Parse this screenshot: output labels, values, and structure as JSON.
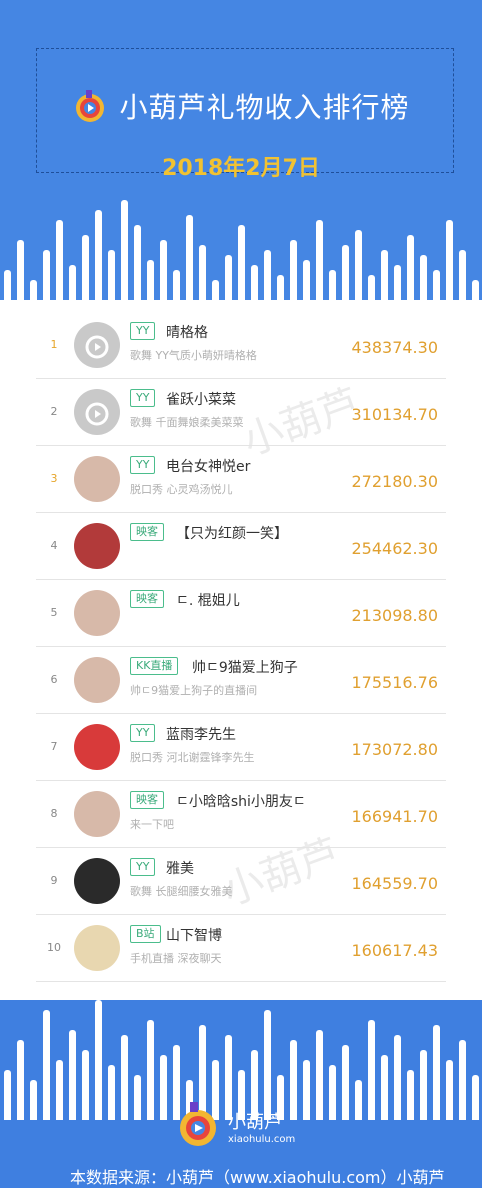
{
  "header": {
    "title": "小葫芦礼物收入排行榜",
    "date": "2018年2月7日"
  },
  "rankings": [
    {
      "rank": "1",
      "platform": "YY",
      "name": "晴格格",
      "desc": "歌舞 YY气质小萌妍晴格格",
      "score": "438374.30",
      "avatar": "default-avatar"
    },
    {
      "rank": "2",
      "platform": "YY",
      "name": "雀跃小菜菜",
      "desc": "歌舞 千面舞娘柔美菜菜",
      "score": "310134.70",
      "avatar": "default-avatar"
    },
    {
      "rank": "3",
      "platform": "YY",
      "name": "电台女神悦er",
      "desc": "脱口秀 心灵鸡汤悦儿",
      "score": "272180.30",
      "avatar": "photo"
    },
    {
      "rank": "4",
      "platform": "映客",
      "name": "【只为红颜一笑】",
      "desc": "",
      "score": "254462.30",
      "avatar": "photo-car"
    },
    {
      "rank": "5",
      "platform": "映客",
      "name": "ㄷ. 棍姐儿",
      "desc": "",
      "score": "213098.80",
      "avatar": "photo"
    },
    {
      "rank": "6",
      "platform": "KK直播",
      "name": "帅ㄷ9猫爱上狗子",
      "desc": "帅ㄷ9猫爱上狗子的直播间",
      "score": "175516.76",
      "avatar": "photo"
    },
    {
      "rank": "7",
      "platform": "YY",
      "name": "蓝雨李先生",
      "desc": "脱口秀 河北谢霆锋李先生",
      "score": "173072.80",
      "avatar": "cartoon"
    },
    {
      "rank": "8",
      "platform": "映客",
      "name": "ㄷ小晗晗shi小朋友ㄷ",
      "desc": "来一下吧",
      "score": "166941.70",
      "avatar": "photo"
    },
    {
      "rank": "9",
      "platform": "YY",
      "name": "雅美",
      "desc": "歌舞 长腿细腰女雅美",
      "score": "164559.70",
      "avatar": "photo-dark"
    },
    {
      "rank": "10",
      "platform": "B站",
      "name": "山下智博",
      "desc": "手机直播 深夜聊天",
      "score": "160617.43",
      "avatar": "cartoon-glasses"
    }
  ],
  "footer": {
    "brand": "小葫芦",
    "url": "xiaohulu.com",
    "source": "本数据来源：小葫芦（www.xiaohulu.com）小葫芦"
  },
  "watermark": "小葫芦",
  "colors": {
    "background": "#3f7fe0",
    "date": "#f1c232",
    "score": "#e0a030",
    "tag": "#3aaa7a"
  }
}
